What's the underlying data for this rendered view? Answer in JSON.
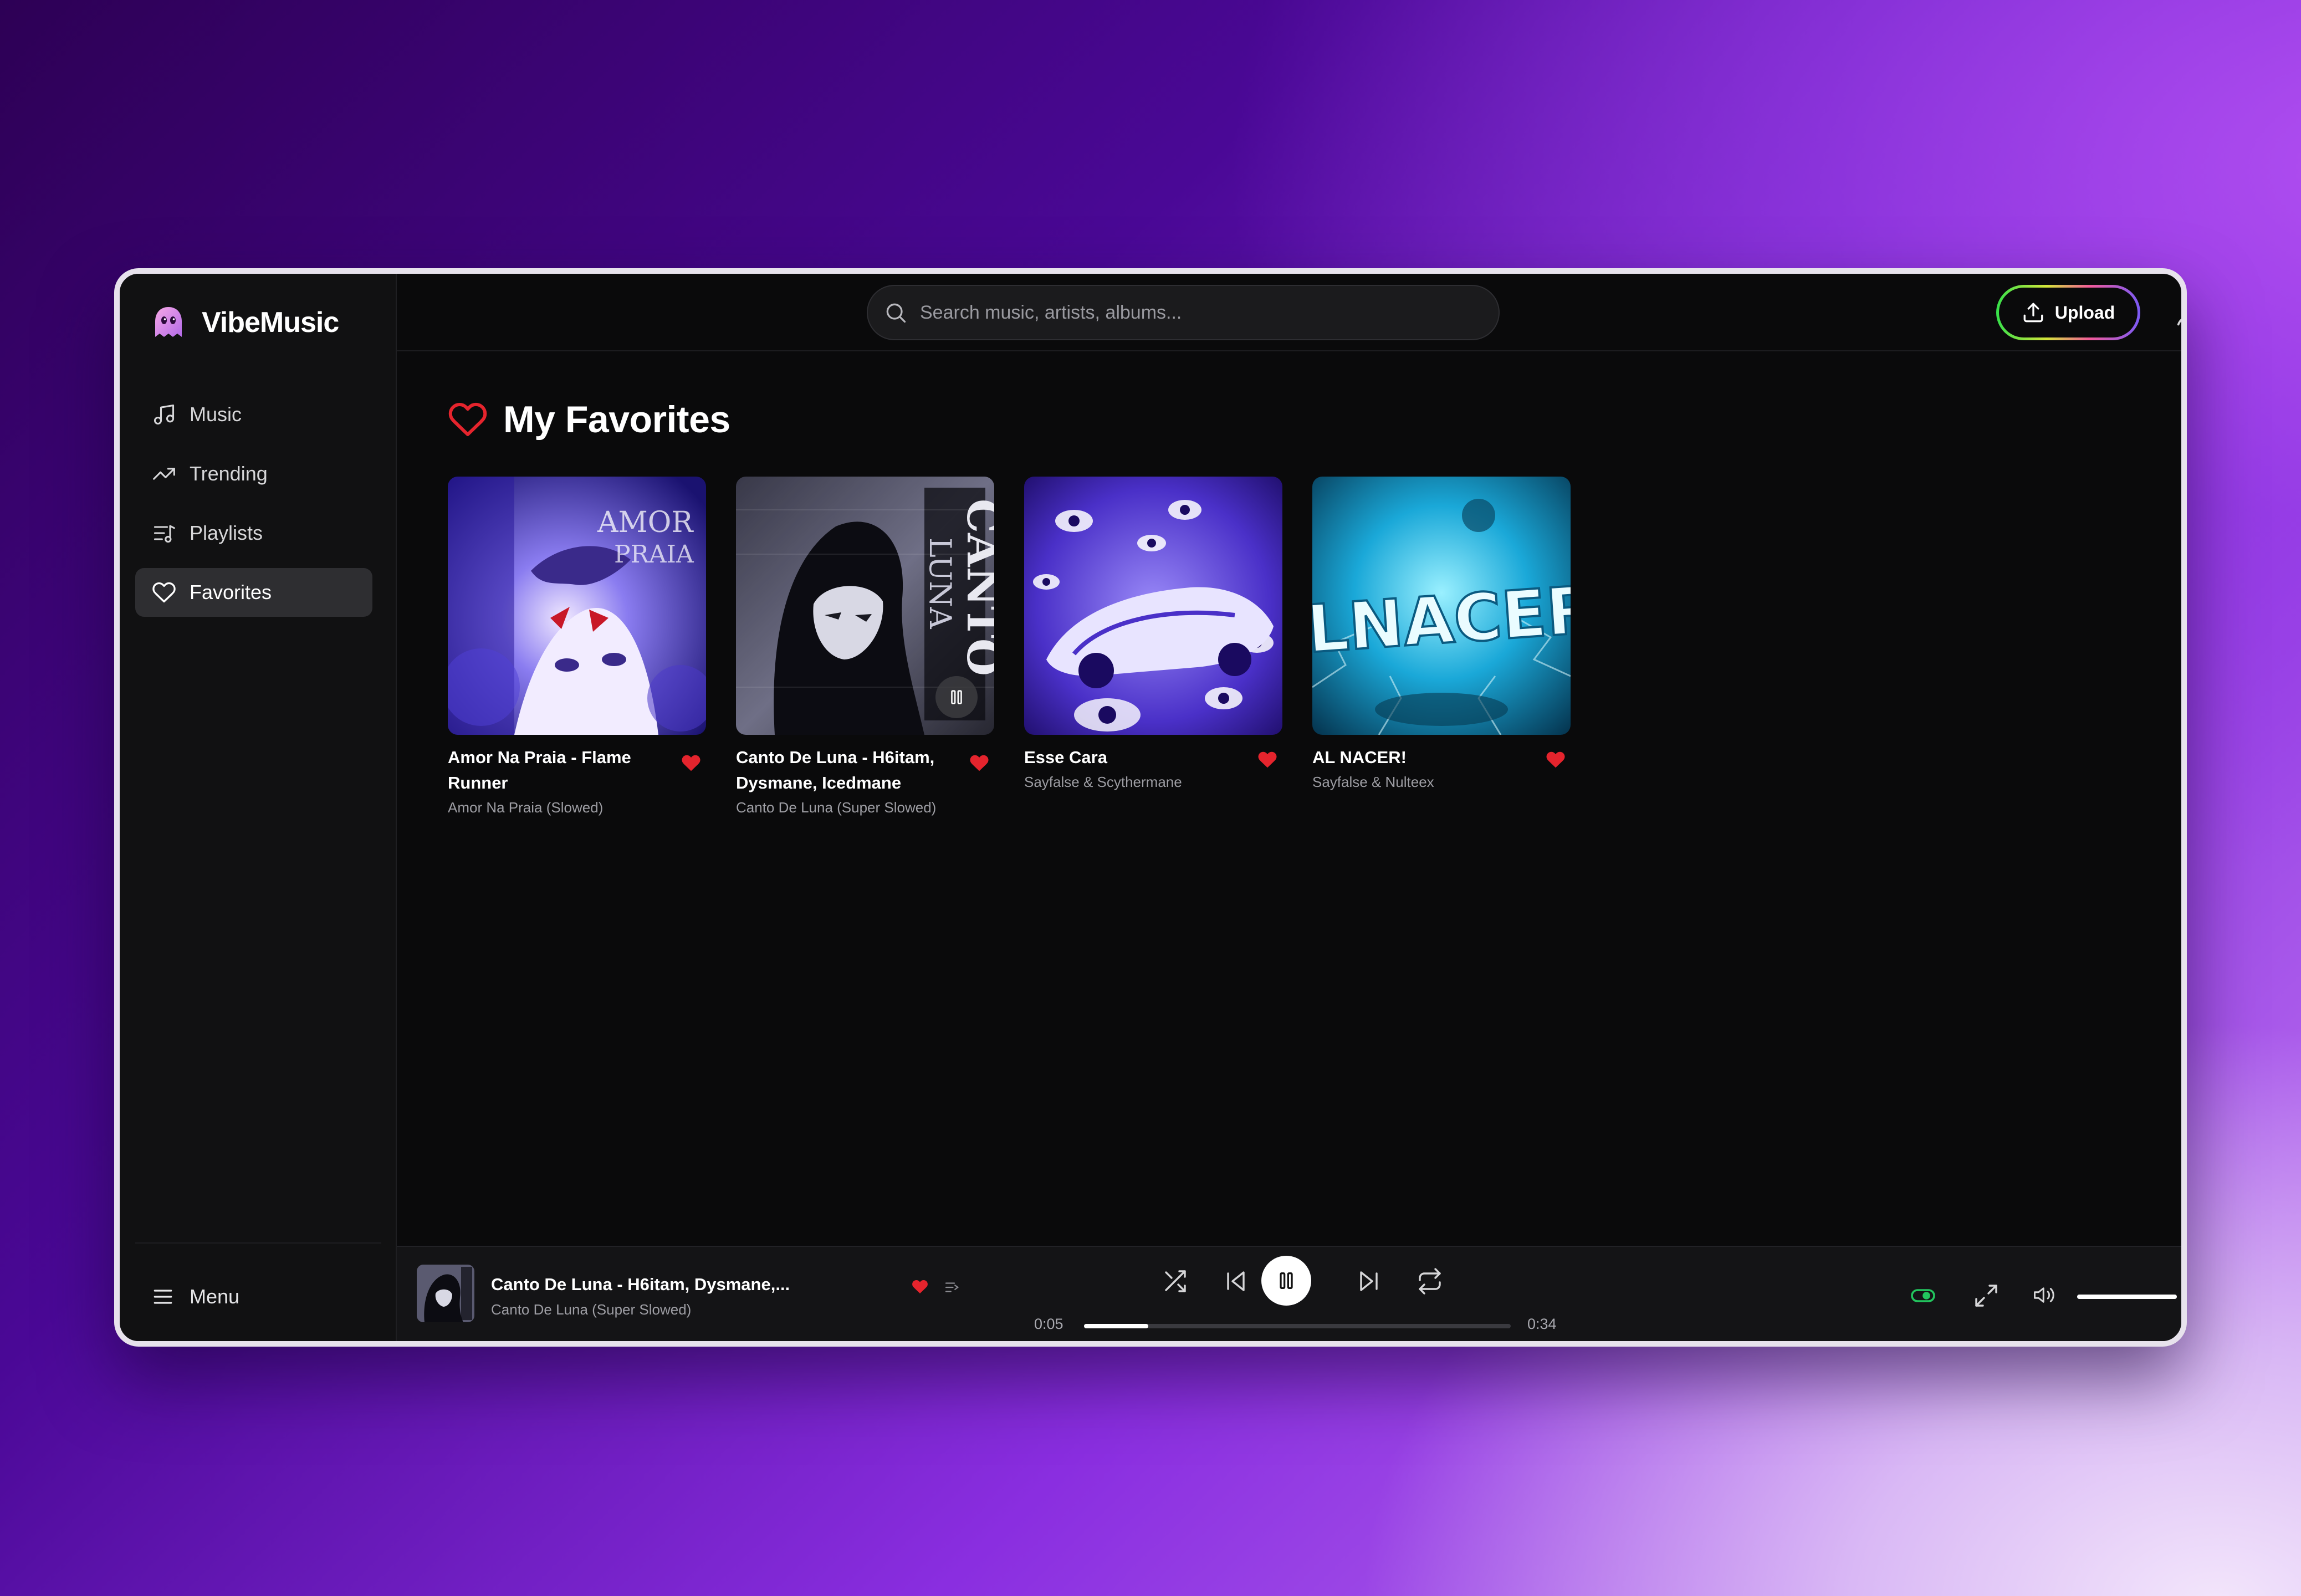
{
  "app": {
    "name": "VibeMusic"
  },
  "sidebar": {
    "items": [
      {
        "label": "Music",
        "icon": "music-note-icon",
        "active": false
      },
      {
        "label": "Trending",
        "icon": "trending-icon",
        "active": false
      },
      {
        "label": "Playlists",
        "icon": "playlist-icon",
        "active": false
      },
      {
        "label": "Favorites",
        "icon": "heart-icon",
        "active": true
      }
    ],
    "menu_label": "Menu"
  },
  "header": {
    "search_placeholder": "Search music, artists, albums...",
    "upload_label": "Upload"
  },
  "page": {
    "title": "My Favorites"
  },
  "favorites": [
    {
      "title": "Amor Na Praia - Flame Runner",
      "subtitle": "Amor Na Praia (Slowed)",
      "favorited": true
    },
    {
      "title": "Canto De Luna - H6itam, Dysmane, Icedmane",
      "subtitle": "Canto De Luna (Super Slowed)",
      "favorited": true,
      "playing": true
    },
    {
      "title": "Esse Cara",
      "subtitle": "Sayfalse & Scythermane",
      "favorited": true
    },
    {
      "title": "AL NACER!",
      "subtitle": "Sayfalse & Nulteex",
      "favorited": true
    }
  ],
  "player": {
    "title": "Canto De Luna - H6itam, Dysmane,...",
    "subtitle": "Canto De Luna (Super Slowed)",
    "current_time": "0:05",
    "duration": "0:34",
    "progress_fraction": 0.15,
    "volume_fraction": 1.0
  },
  "colors": {
    "accent_heart": "#e5242d",
    "toggle_green": "#22c55e",
    "background": "#0a0a0b"
  }
}
